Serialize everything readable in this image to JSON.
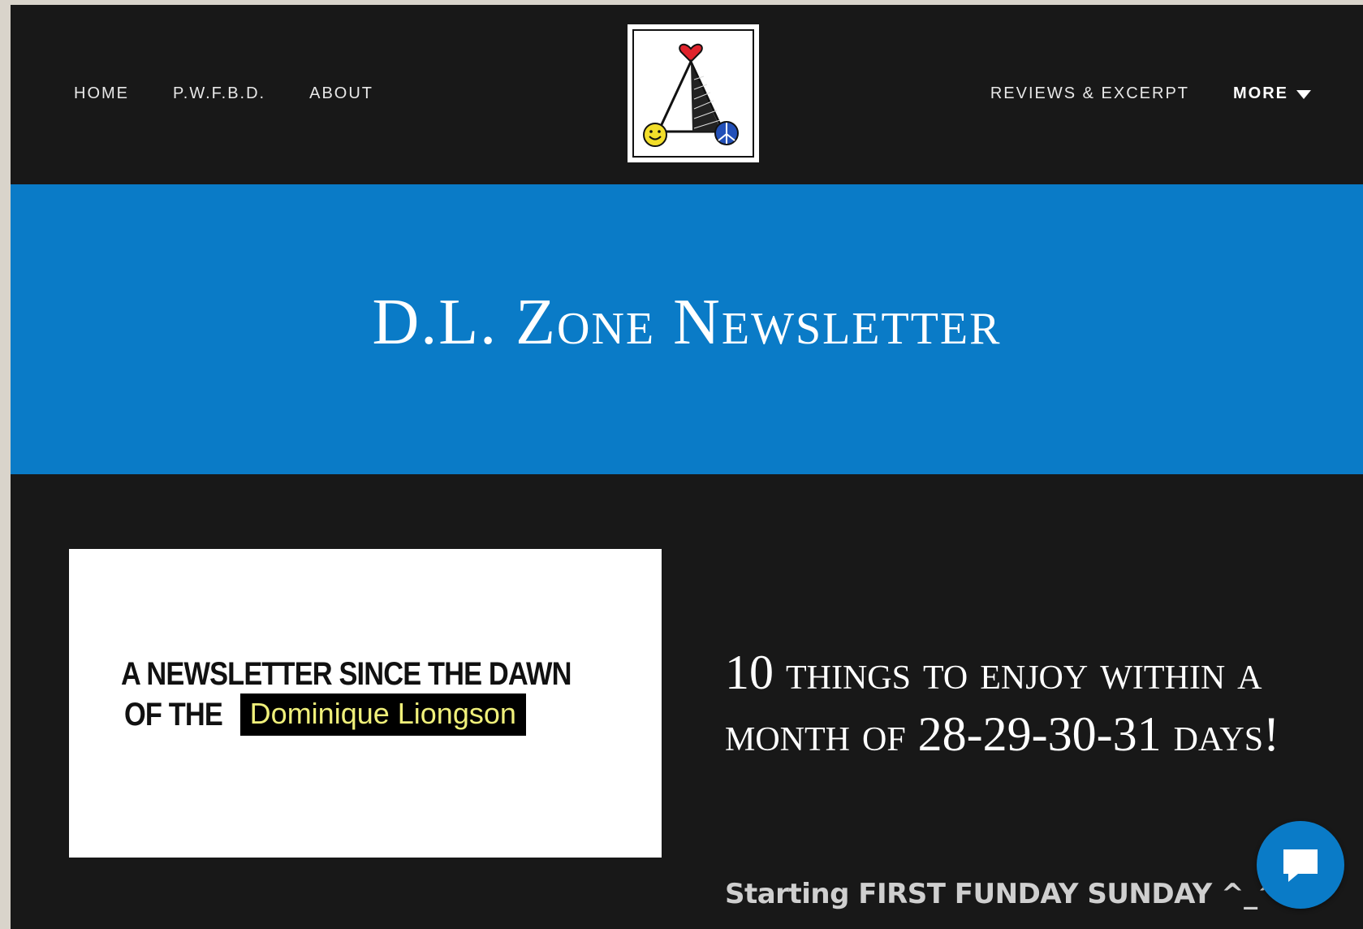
{
  "nav": {
    "left": [
      {
        "label": "HOME"
      },
      {
        "label": "P.W.F.B.D."
      },
      {
        "label": "ABOUT"
      }
    ],
    "right": [
      {
        "label": "REVIEWS & EXCERPT"
      }
    ],
    "more_label": "MORE",
    "logo_icon": "pyramid-heart-peace-logo"
  },
  "hero": {
    "title": "D.L. Zone Newsletter",
    "background_color": "#0a7bc7"
  },
  "article": {
    "image": {
      "line1": "A NEWSLETTER SINCE THE DAWN",
      "line2_prefix": "OF THE",
      "highlight_name": "Dominique Liongson",
      "highlight_color": "#f0f07a"
    },
    "title": "10 things to enjoy within a month of 28-29-30-31 days!",
    "subtitle": "Starting FIRST FUNDAY SUNDAY  ^_^"
  },
  "chat": {
    "icon": "chat-bubble-icon",
    "color": "#0a7bc7"
  }
}
